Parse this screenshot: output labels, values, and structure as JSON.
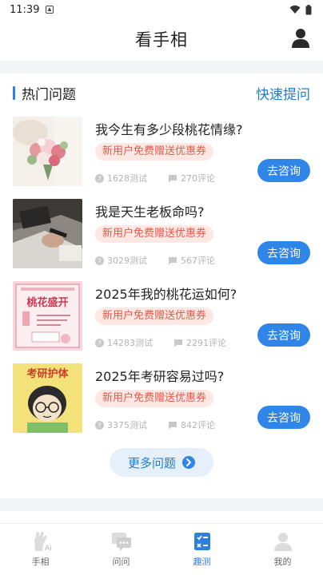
{
  "status_bar": {
    "time": "11:39"
  },
  "header": {
    "title": "看手相"
  },
  "section": {
    "title": "热门问题",
    "quick_ask": "快速提问"
  },
  "questions": [
    {
      "title": "我今生有多少段桃花情缘?",
      "badge": "新用户免费赠送优惠券",
      "tests": "1628测试",
      "comments": "270评论",
      "button": "去咨询"
    },
    {
      "title": "我是天生老板命吗?",
      "badge": "新用户免费赠送优惠券",
      "tests": "3029测试",
      "comments": "567评论",
      "button": "去咨询"
    },
    {
      "title": "2025年我的桃花运如何?",
      "badge": "新用户免费赠送优惠券",
      "tests": "14283测试",
      "comments": "2291评论",
      "button": "去咨询"
    },
    {
      "title": "2025年考研容易过吗?",
      "badge": "新用户免费赠送优惠券",
      "tests": "3375测试",
      "comments": "842评论",
      "button": "去咨询"
    }
  ],
  "thumbnails": {
    "peach_text": "桃花盛开",
    "exam_text": "考研护体"
  },
  "more_button": "更多问题",
  "tabs": [
    {
      "label": "手相",
      "icon": "palm-ai-icon",
      "active": false
    },
    {
      "label": "问问",
      "icon": "chat-icon",
      "active": false
    },
    {
      "label": "趣测",
      "icon": "quiz-icon",
      "active": true
    },
    {
      "label": "我的",
      "icon": "profile-icon",
      "active": false
    }
  ],
  "colors": {
    "accent": "#2f7fe0",
    "badge_bg": "#fde8e4",
    "badge_text": "#e45a4a"
  }
}
